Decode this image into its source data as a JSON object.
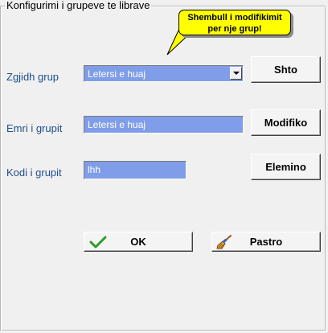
{
  "group": {
    "title": "Konfigurimi i grupeve te librave"
  },
  "tooltip": {
    "line1": "Shembull i modifikimit",
    "line2": "per nje grup!"
  },
  "form": {
    "select_group_label": "Zgjidh grup",
    "select_group_value": "Letersi e huaj",
    "group_name_label": "Emri i grupit",
    "group_name_value": "Letersi e huaj",
    "group_code_label": "Kodi i grupit",
    "group_code_value": "lhh"
  },
  "buttons": {
    "add": "Shto",
    "modify": "Modifiko",
    "delete": "Elemino",
    "ok": "OK",
    "clear": "Pastro"
  },
  "colors": {
    "field_background": "#7f9de8",
    "label_text": "#1f4e8c",
    "tooltip_background": "#ffff00",
    "ok_icon": "#2e9b2e"
  },
  "icons": {
    "ok": "checkmark-icon",
    "clear": "broom-icon",
    "combo": "chevron-down-icon"
  }
}
